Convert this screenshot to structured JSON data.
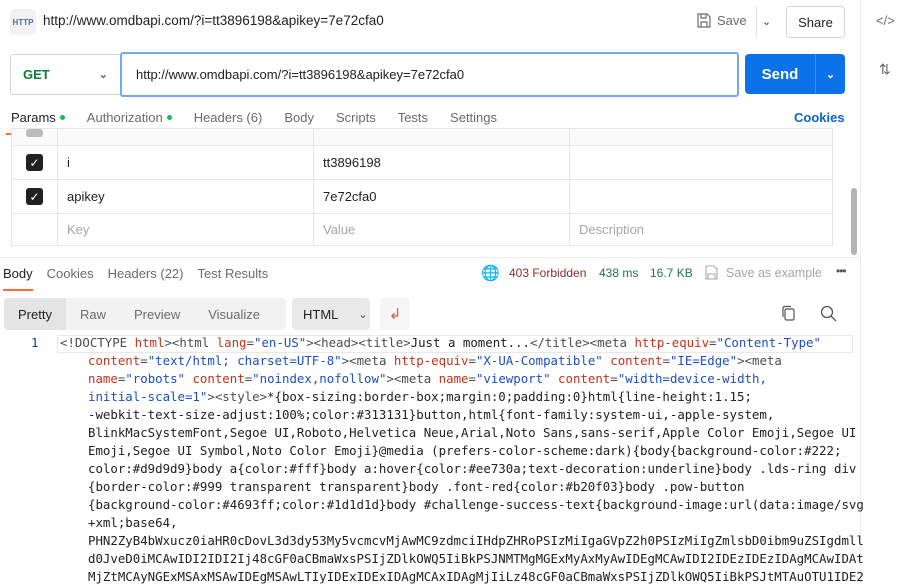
{
  "header": {
    "title": "http://www.omdbapi.com/?i=tt3896198&apikey=7e72cfa0",
    "icon": "http-icon",
    "save_label": "Save",
    "share_label": "Share"
  },
  "request": {
    "method": "GET",
    "url": "http://www.omdbapi.com/?i=tt3896198&apikey=7e72cfa0",
    "send_label": "Send"
  },
  "tabs": [
    {
      "label": "Params",
      "dot": true
    },
    {
      "label": "Authorization",
      "dot": true
    },
    {
      "label": "Headers (6)"
    },
    {
      "label": "Body"
    },
    {
      "label": "Scripts"
    },
    {
      "label": "Tests"
    },
    {
      "label": "Settings"
    }
  ],
  "cookies_label": "Cookies",
  "params": {
    "rows": [
      {
        "key": "i",
        "value": "tt3896198",
        "checked": true
      },
      {
        "key": "apikey",
        "value": "7e72cfa0",
        "checked": true
      }
    ],
    "placeholders": {
      "key": "Key",
      "value": "Value",
      "description": "Description"
    }
  },
  "response": {
    "tabs": [
      "Body",
      "Cookies",
      "Headers (22)",
      "Test Results"
    ],
    "status": "403 Forbidden",
    "time": "438 ms",
    "size": "16.7 KB",
    "save_example": "Save as example",
    "views": [
      "Pretty",
      "Raw",
      "Preview",
      "Visualize"
    ],
    "format": "HTML",
    "line_number": "1",
    "colors": {
      "status": "#8b2e2e",
      "metric": "#1e7a3d"
    },
    "code_lines": [
      [
        [
          "tag",
          "<!DOCTYPE "
        ],
        [
          "attr",
          "html"
        ],
        [
          "tag",
          "><html "
        ],
        [
          "attr",
          "lang"
        ],
        [
          "tag",
          "="
        ],
        [
          "val",
          "\"en-US\""
        ],
        [
          "tag",
          "><head><title>"
        ],
        [
          "txt",
          "Just a moment..."
        ],
        [
          "tag",
          "</title><meta "
        ],
        [
          "attr",
          "http-equiv"
        ],
        [
          "tag",
          "="
        ],
        [
          "val",
          "\"Content-Type\""
        ]
      ],
      [
        [
          "attr",
          "content"
        ],
        [
          "tag",
          "="
        ],
        [
          "val",
          "\"text/html; charset=UTF-8\""
        ],
        [
          "tag",
          "><meta "
        ],
        [
          "attr",
          "http-equiv"
        ],
        [
          "tag",
          "="
        ],
        [
          "val",
          "\"X-UA-Compatible\""
        ],
        [
          "tag",
          " "
        ],
        [
          "attr",
          "content"
        ],
        [
          "tag",
          "="
        ],
        [
          "val",
          "\"IE=Edge\""
        ],
        [
          "tag",
          "><meta"
        ]
      ],
      [
        [
          "attr",
          "name"
        ],
        [
          "tag",
          "="
        ],
        [
          "val",
          "\"robots\""
        ],
        [
          "tag",
          " "
        ],
        [
          "attr",
          "content"
        ],
        [
          "tag",
          "="
        ],
        [
          "val",
          "\"noindex,nofollow\""
        ],
        [
          "tag",
          "><meta "
        ],
        [
          "attr",
          "name"
        ],
        [
          "tag",
          "="
        ],
        [
          "val",
          "\"viewport\""
        ],
        [
          "tag",
          " "
        ],
        [
          "attr",
          "content"
        ],
        [
          "tag",
          "="
        ],
        [
          "val",
          "\"width=device-width,"
        ]
      ],
      [
        [
          "val",
          "initial-scale=1\""
        ],
        [
          "tag",
          "><style>"
        ],
        [
          "txt",
          "*{box-sizing:border-box;margin:0;padding:0}html{line-height:1.15;"
        ]
      ],
      [
        [
          "txt",
          "-webkit-text-size-adjust:100%;color:#313131}button,html{font-family:system-ui,-apple-system,"
        ]
      ],
      [
        [
          "txt",
          "BlinkMacSystemFont,Segoe UI,Roboto,Helvetica Neue,Arial,Noto Sans,sans-serif,Apple Color Emoji,Segoe UI"
        ]
      ],
      [
        [
          "txt",
          "Emoji,Segoe UI Symbol,Noto Color Emoji}@media (prefers-color-scheme:dark){body{background-color:#222;"
        ]
      ],
      [
        [
          "txt",
          "color:#d9d9d9}body a{color:#fff}body a:hover{color:#ee730a;text-decoration:underline}body .lds-ring div"
        ]
      ],
      [
        [
          "txt",
          "{border-color:#999 transparent transparent}body .font-red{color:#b20f03}body .pow-button"
        ]
      ],
      [
        [
          "txt",
          "{background-color:#4693ff;color:#1d1d1d}body #challenge-success-text{background-image:url(data:image/svg"
        ]
      ],
      [
        [
          "txt",
          "+xml;base64,"
        ]
      ],
      [
        [
          "txt",
          "PHN2ZyB4bWxucz0iaHR0cDovL3d3dy53My5vcmcvMjAwMC9zdmciIHdpZHRoPSIzMiIgaGVpZ2h0PSIzMiIgZmlsbD0ibm9uZSIgdmll"
        ]
      ],
      [
        [
          "txt",
          "d0JveD0iMCAwIDI2IDI2Ij48cGF0aCBmaWxsPSIjZDlkOWQ5IiBkPSJNMTMgMGExMyAxMyAwIDEgMCAwIDI2IDEzIDEzIDAgMCAwIDAt"
        ]
      ],
      [
        [
          "txt",
          "MjZtMCAyNGExMSAxMSAwIDEgMSAwLTIyIDExIDExIDAgMCAxIDAgMjIiLz48cGF0aCBmaWxsPSIjZDlkOWQ5IiBkPSJtMTAuOTU1IDE2"
        ]
      ]
    ]
  }
}
